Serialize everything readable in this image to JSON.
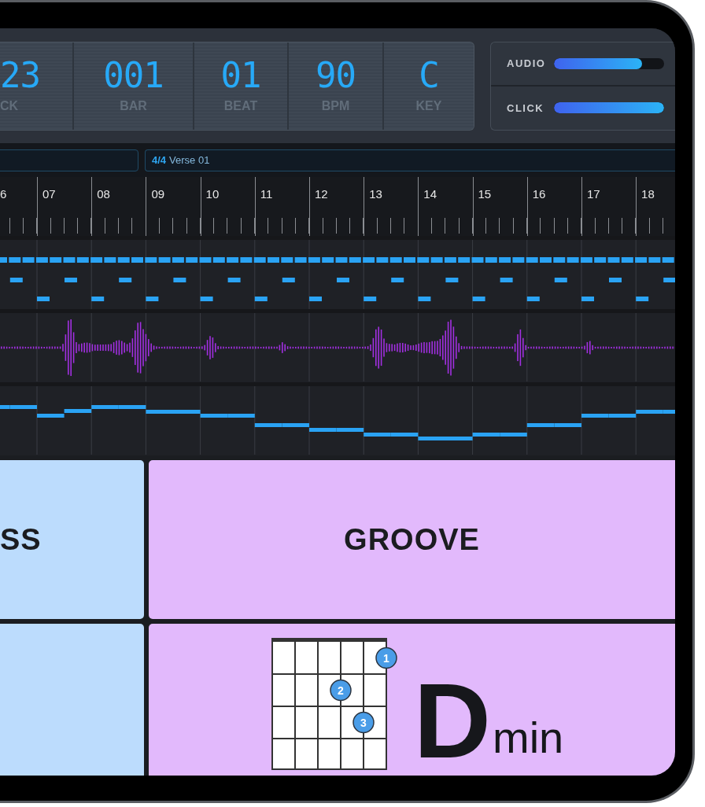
{
  "counters": [
    {
      "value": "23",
      "label": "CK"
    },
    {
      "value": "001",
      "label": "BAR"
    },
    {
      "value": "01",
      "label": "BEAT"
    },
    {
      "value": "90",
      "label": "BPM"
    },
    {
      "value": "C",
      "label": "KEY"
    }
  ],
  "mixer": [
    {
      "label": "AUDIO",
      "level": 0.8
    },
    {
      "label": "CLICK",
      "level": 1
    }
  ],
  "section": {
    "meter": "4/4",
    "name": "Verse 01"
  },
  "ruler": {
    "bars": [
      "6",
      "07",
      "08",
      "09",
      "10",
      "11",
      "12",
      "13",
      "14",
      "15",
      "16",
      "17",
      "18"
    ]
  },
  "pads": [
    {
      "kind": "label",
      "label": "SS",
      "color": "#bcdcfd"
    },
    {
      "kind": "label",
      "label": "GROOVE",
      "color": "#e2b9fc"
    },
    {
      "kind": "empty",
      "color": "#bcdcfd"
    },
    {
      "kind": "chord",
      "color": "#e2b9fc",
      "root": "D",
      "quality": "min",
      "fingers": [
        {
          "label": "1"
        },
        {
          "label": "2"
        },
        {
          "label": "3"
        }
      ]
    }
  ]
}
